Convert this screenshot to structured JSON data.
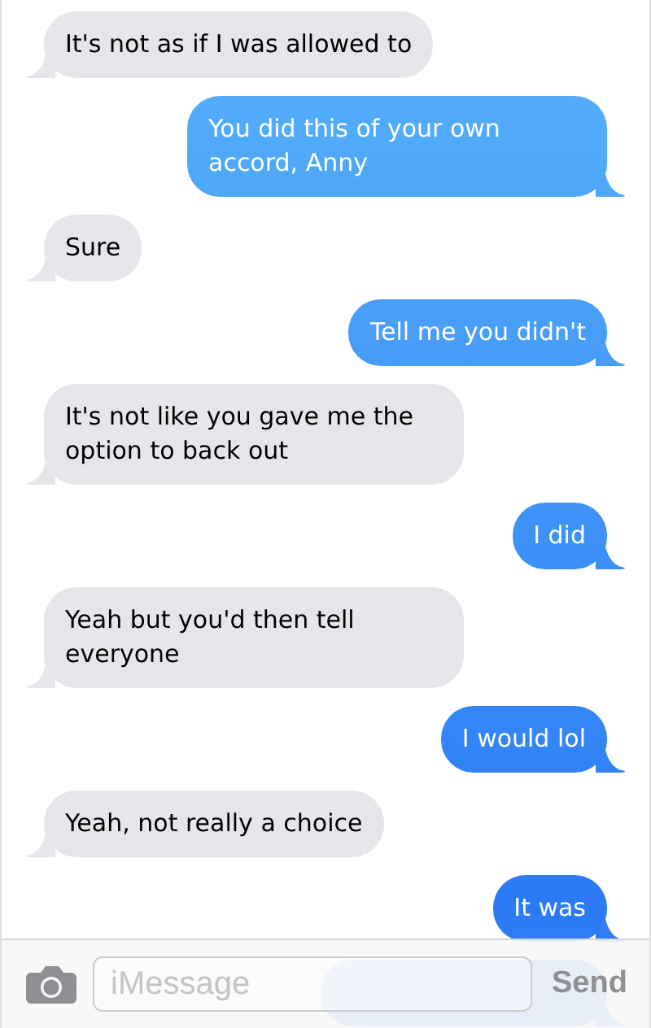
{
  "messages": [
    {
      "text": "It's not as if I was allowed to",
      "kind": "received"
    },
    {
      "text": "You did this of your own accord, Anny",
      "kind": "sent"
    },
    {
      "text": "Sure",
      "kind": "received"
    },
    {
      "text": "Tell me you didn't",
      "kind": "sent"
    },
    {
      "text": "It's not like you gave me the option to back out",
      "kind": "received"
    },
    {
      "text": "I did",
      "kind": "sent"
    },
    {
      "text": "Yeah but you'd then tell everyone",
      "kind": "received"
    },
    {
      "text": "I would lol",
      "kind": "sent"
    },
    {
      "text": "Yeah, not really a choice",
      "kind": "received"
    },
    {
      "text": "It was",
      "kind": "sent"
    },
    {
      "kind": "hidden"
    }
  ],
  "composer": {
    "placeholder": "iMessage",
    "send": "Send"
  }
}
